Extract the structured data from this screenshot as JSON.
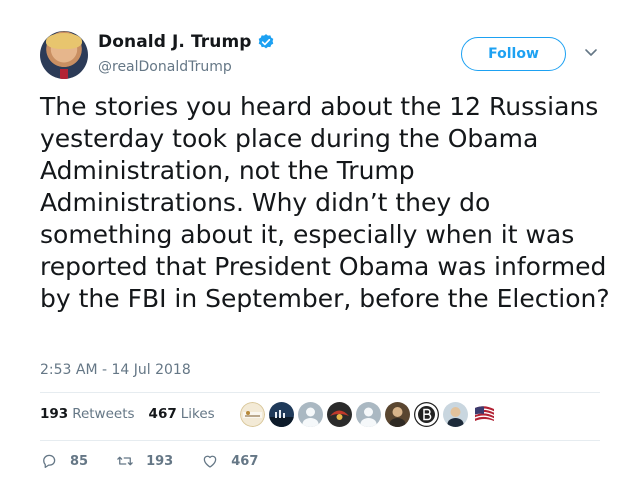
{
  "author": {
    "display_name": "Donald J. Trump",
    "handle": "@realDonaldTrump",
    "verified": true
  },
  "follow_label": "Follow",
  "tweet": {
    "text": "The stories you heard about the 12 Russians yesterday took place during the Obama Administration, not the Trump Administrations. Why didn’t they do something about it, especially when it was reported that President Obama was informed by the FBI in September, before the Election?",
    "timestamp": "2:53 AM - 14 Jul 2018"
  },
  "stats": {
    "retweets_count": "193",
    "retweets_label": "Retweets",
    "likes_count": "467",
    "likes_label": "Likes"
  },
  "liker_avatars": [
    "CRP logo",
    "skyline",
    "default",
    "eagle",
    "default",
    "portrait",
    "B logo",
    "portrait",
    "US flag"
  ],
  "actions": {
    "reply_count": "85",
    "retweet_count": "193",
    "like_count": "467"
  },
  "colors": {
    "accent": "#1da1f2",
    "muted": "#657786",
    "text": "#14171a"
  }
}
